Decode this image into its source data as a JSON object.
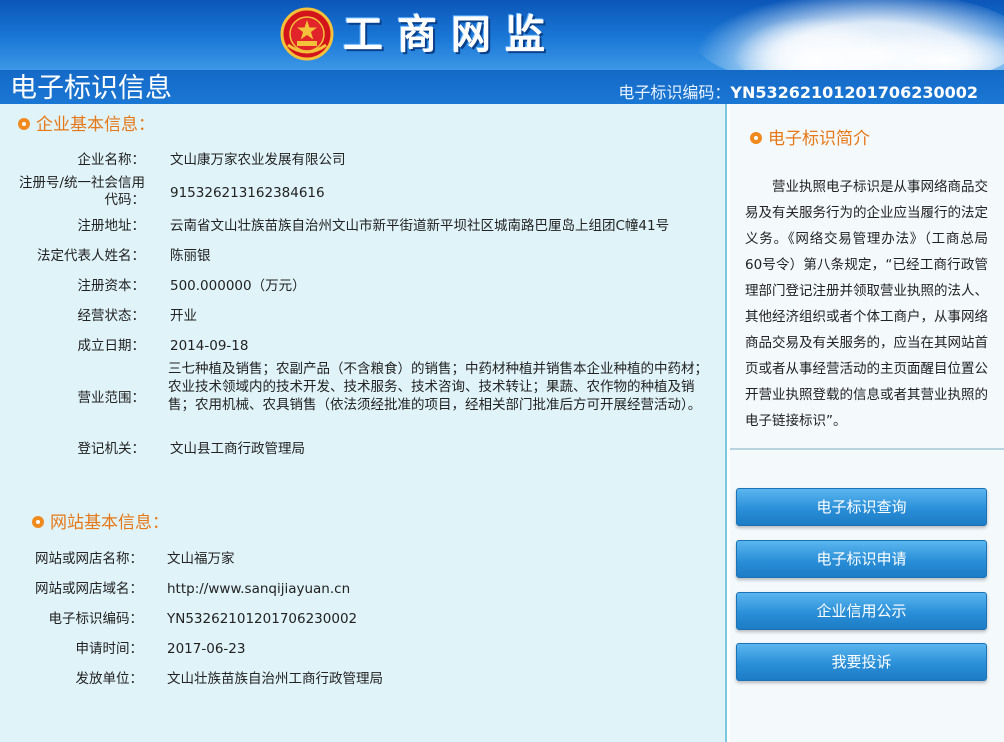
{
  "banner": {
    "brand_title": "工商网监"
  },
  "titlebar": {
    "page_title": "电子标识信息",
    "code_label": "电子标识编码：",
    "code_value": "YN53262101201706230002"
  },
  "enterprise": {
    "heading": "企业基本信息：",
    "rows": [
      {
        "label": "企业名称：",
        "value": "文山康万家农业发展有限公司"
      },
      {
        "label": "注册号/统一社会信用代码：",
        "value": "915326213162384616"
      },
      {
        "label": "注册地址：",
        "value": "云南省文山壮族苗族自治州文山市新平街道新平坝社区城南路巴厘岛上组团C幢41号"
      },
      {
        "label": "法定代表人姓名：",
        "value": "陈丽银"
      },
      {
        "label": "注册资本：",
        "value": "500.000000（万元）"
      },
      {
        "label": "经营状态：",
        "value": "开业"
      },
      {
        "label": "成立日期：",
        "value": "2014-09-18"
      },
      {
        "label": "营业范围：",
        "value": "三七种植及销售；农副产品（不含粮食）的销售；中药材种植并销售本企业种植的中药材；农业技术领域内的技术开发、技术服务、技术咨询、技术转让；果蔬、农作物的种植及销售；农用机械、农具销售（依法须经批准的项目，经相关部门批准后方可开展经营活动）。"
      },
      {
        "label": "登记机关：",
        "value": "文山县工商行政管理局"
      }
    ]
  },
  "website": {
    "heading": "网站基本信息：",
    "rows": [
      {
        "label": "网站或网店名称：",
        "value": "文山福万家"
      },
      {
        "label": "网站或网店域名：",
        "value": "http://www.sanqijiayuan.cn"
      },
      {
        "label": "电子标识编码：",
        "value": "YN53262101201706230002"
      },
      {
        "label": "申请时间：",
        "value": "2017-06-23"
      },
      {
        "label": "发放单位：",
        "value": "文山壮族苗族自治州工商行政管理局"
      }
    ]
  },
  "intro": {
    "heading": "电子标识简介",
    "text": "营业执照电子标识是从事网络商品交易及有关服务行为的企业应当履行的法定义务。《网络交易管理办法》（工商总局60号令）第八条规定，“已经工商行政管理部门登记注册并领取营业执照的法人、其他经济组织或者个体工商户，从事网络商品交易及有关服务的，应当在其网站首页或者从事经营活动的主页面醒目位置公开营业执照登载的信息或者其营业执照的电子链接标识”。"
  },
  "buttons": {
    "query": "电子标识查询",
    "apply": "电子标识申请",
    "credit": "企业信用公示",
    "complain": "我要投诉"
  },
  "colors": {
    "accent": "#e67817",
    "header_blue": "#1a77d4",
    "panel_bg": "#dff3f8"
  }
}
